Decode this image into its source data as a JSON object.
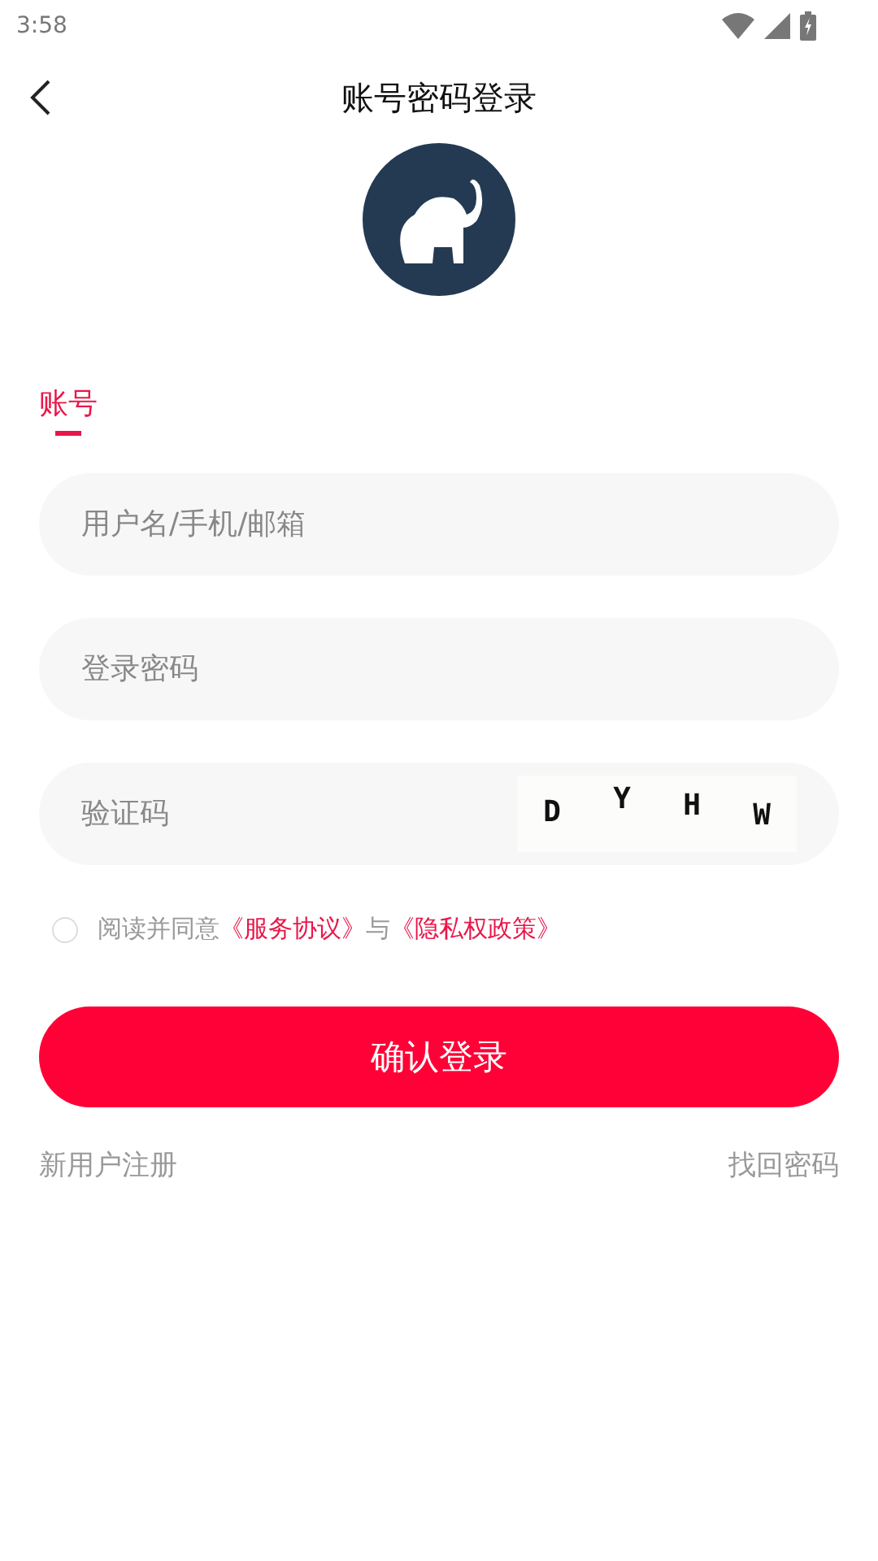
{
  "status_bar": {
    "time": "3:58"
  },
  "header": {
    "title": "账号密码登录"
  },
  "tabs": [
    {
      "label": "账号",
      "selected": true
    }
  ],
  "fields": [
    {
      "kind": "text",
      "placeholder": "用户名/手机/邮箱"
    },
    {
      "kind": "password",
      "placeholder": "登录密码"
    },
    {
      "kind": "captcha",
      "placeholder": "验证码",
      "captcha": [
        "D",
        "Y",
        "H",
        "W"
      ]
    }
  ],
  "agreement": {
    "checked": false,
    "parts": [
      {
        "kind": "plain",
        "text": "阅读并同意"
      },
      {
        "kind": "link",
        "text": "《服务协议》"
      },
      {
        "kind": "plain",
        "text": "与"
      },
      {
        "kind": "link",
        "text": "《隐私权政策》"
      }
    ]
  },
  "login_button": {
    "label": "确认登录"
  },
  "footer_links": [
    "新用户注册",
    "找回密码"
  ]
}
